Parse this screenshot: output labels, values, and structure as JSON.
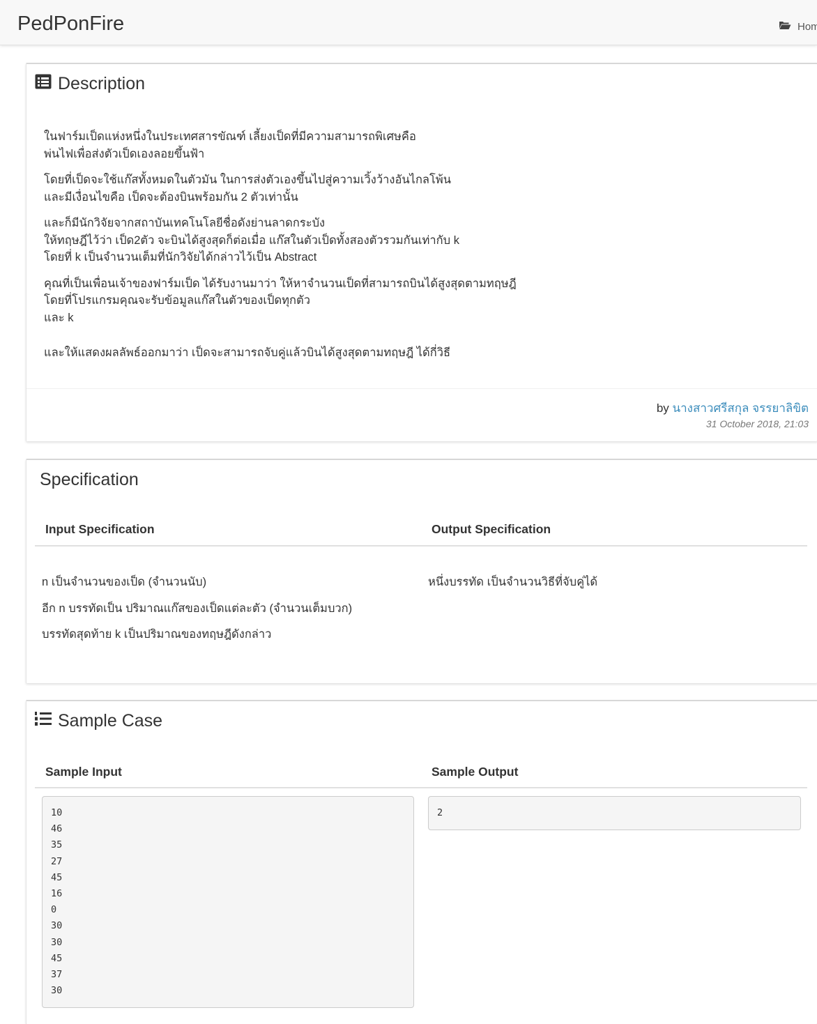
{
  "navbar": {
    "brand": "PedPonFire",
    "breadcrumb": "Home"
  },
  "description": {
    "title": "Description",
    "paragraphs": [
      [
        "ในฟาร์มเป็ดแห่งหนึ่งในประเทศสารขัณฑ์ เลี้ยงเป็ดที่มีความสามารถพิเศษคือ",
        "พ่นไฟเพื่อส่งตัวเป็ดเองลอยขึ้นฟ้า"
      ],
      [
        "โดยที่เป็ดจะใช้แก๊สทั้งหมดในตัวมัน ในการส่งตัวเองขึ้นไปสู่ความเวิ้งว้างอันไกลโพ้น",
        "และมีเงื่อนไขคือ เป็ดจะต้องบินพร้อมกัน 2 ตัวเท่านั้น"
      ],
      [
        "และก็มีนักวิจัยจากสถาบันเทคโนโลยีชื่อดังย่านลาดกระบัง",
        "ให้ทฤษฎีไว้ว่า เป็ด2ตัว จะบินได้สูงสุดก็ต่อเมื่อ แก๊สในตัวเป็ดทั้งสองตัวรวมกันเท่ากับ k",
        "โดยที่ k เป็นจำนวนเต็มที่นักวิจัยได้กล่าวไว้เป็น Abstract"
      ],
      [
        "คุณที่เป็นเพื่อนเจ้าของฟาร์มเป็ด ได้รับงานมาว่า ให้หาจำนวนเป็ดที่สามารถบินได้สูงสุดตามทฤษฎี",
        "โดยที่โปรแกรมคุณจะรับข้อมูลแก๊สในตัวของเป็ดทุกตัว",
        "และ k"
      ],
      [
        "และให้แสดงผลลัพธ์ออกมาว่า เป็ดจะสามารถจับคู่แล้วบินได้สูงสุดตามทฤษฎี ได้กี่วิธี"
      ]
    ],
    "by_label": "by",
    "author": "นางสาวศรีสกุล จรรยาลิขิต",
    "timestamp": "31 October 2018, 21:03"
  },
  "specification": {
    "title": "Specification",
    "input_header": "Input Specification",
    "output_header": "Output Specification",
    "input_lines": [
      "n เป็นจำนวนของเป็ด (จำนวนนับ)",
      "อีก n บรรทัดเป็น ปริมาณแก๊สของเป็ดแต่ละตัว (จำนวนเต็มบวก)",
      "บรรทัดสุดท้าย k เป็นปริมาณของทฤษฎีดังกล่าว"
    ],
    "output_lines": [
      "หนึ่งบรรทัด เป็นจำนวนวิธีที่จับคู่ได้"
    ]
  },
  "sample_case": {
    "title": "Sample Case",
    "input_header": "Sample Input",
    "output_header": "Sample Output",
    "input": "10\n46\n35\n27\n45\n16\n0\n30\n30\n45\n37\n30",
    "output": "2"
  },
  "colors": {
    "link": "#3c8dbc",
    "navbar_bg": "#f8f8f8",
    "pre_bg": "#f5f5f5"
  },
  "icons": [
    "folder-open-icon",
    "list-alt-icon",
    "list-ol-icon"
  ]
}
